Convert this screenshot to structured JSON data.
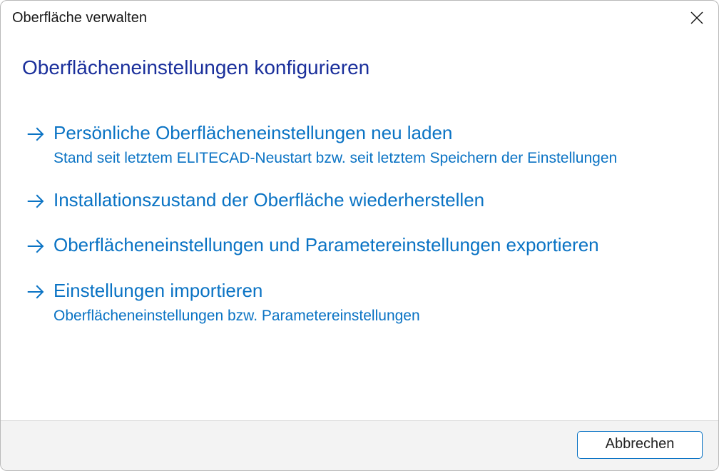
{
  "window": {
    "title": "Oberfläche verwalten"
  },
  "heading": "Oberflächeneinstellungen konfigurieren",
  "options": [
    {
      "title": "Persönliche Oberflächeneinstellungen neu laden",
      "sub": "Stand seit letztem ELITECAD-Neustart bzw. seit letztem Speichern der Einstellungen"
    },
    {
      "title": "Installationszustand der Oberfläche wiederherstellen",
      "sub": ""
    },
    {
      "title": "Oberflächeneinstellungen und Parametereinstellungen exportieren",
      "sub": ""
    },
    {
      "title": "Einstellungen importieren",
      "sub": "Oberflächeneinstellungen bzw. Parametereinstellungen"
    }
  ],
  "footer": {
    "cancel": "Abbrechen"
  }
}
